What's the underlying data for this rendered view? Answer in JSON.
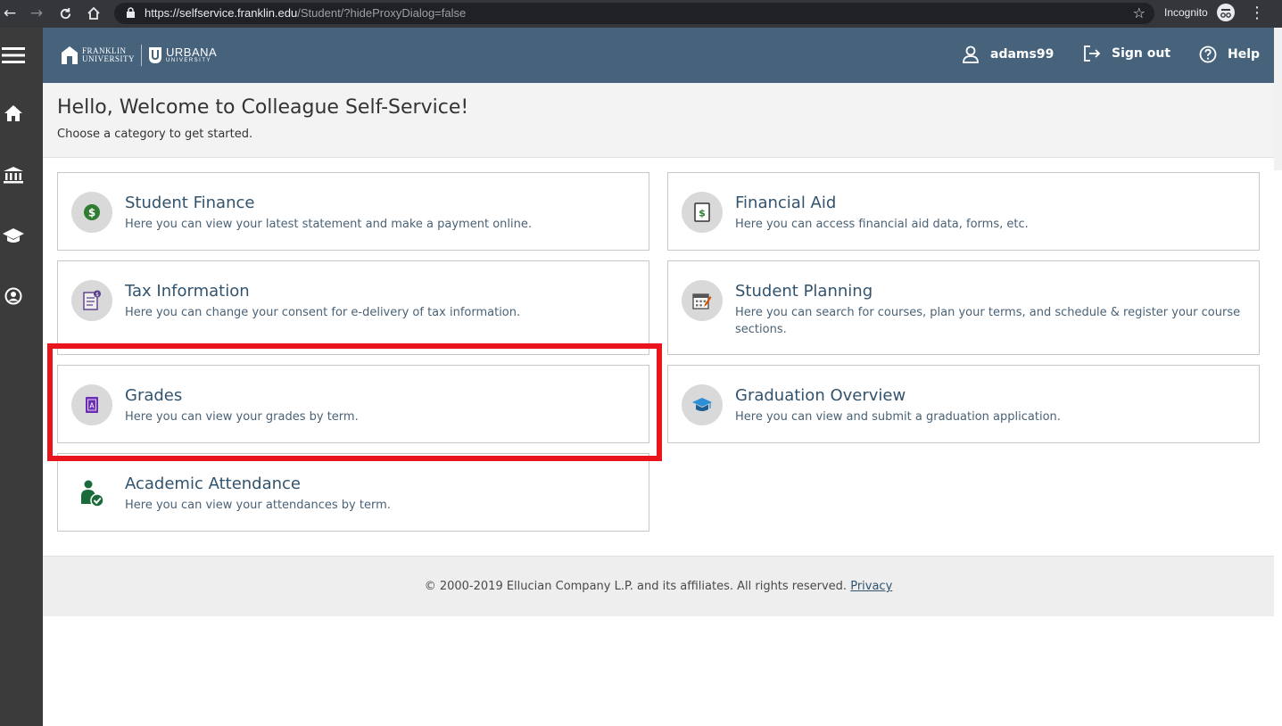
{
  "browser": {
    "url_host": "https://selfservice.franklin.edu",
    "url_path": "/Student/?hideProxyDialog=false",
    "incognito_label": "Incognito"
  },
  "header": {
    "logo_franklin_line1": "FRANKLIN",
    "logo_franklin_line2": "UNIVERSITY",
    "logo_urbana_line1": "URBANA",
    "logo_urbana_line2": "UNIVERSITY",
    "username": "adams99",
    "signout_label": "Sign out",
    "help_label": "Help",
    "background_color": "#47637c"
  },
  "welcome": {
    "title": "Hello, Welcome to Colleague Self-Service!",
    "subtitle": "Choose a category to get started."
  },
  "tiles": [
    {
      "title": "Student Finance",
      "description": "Here you can view your latest statement and make a payment online.",
      "icon": "dollar-coin-icon"
    },
    {
      "title": "Financial Aid",
      "description": "Here you can access financial aid data, forms, etc.",
      "icon": "dollar-document-icon"
    },
    {
      "title": "Tax Information",
      "description": "Here you can change your consent for e-delivery of tax information.",
      "icon": "tax-document-icon"
    },
    {
      "title": "Student Planning",
      "description": "Here you can search for courses, plan your terms, and schedule & register your course sections.",
      "icon": "calendar-pencil-icon"
    },
    {
      "title": "Grades",
      "description": "Here you can view your grades by term.",
      "icon": "grade-book-icon"
    },
    {
      "title": "Graduation Overview",
      "description": "Here you can view and submit a graduation application.",
      "icon": "graduation-cap-icon"
    },
    {
      "title": "Academic Attendance",
      "description": "Here you can view your attendances by term.",
      "icon": "person-check-icon"
    }
  ],
  "footer": {
    "copyright": "© 2000-2019 Ellucian Company L.P. and its affiliates. All rights reserved.",
    "privacy_label": "Privacy"
  },
  "colors": {
    "highlight": "#e8151c",
    "tile_title": "#31536e",
    "rail": "#3b3b3b"
  }
}
